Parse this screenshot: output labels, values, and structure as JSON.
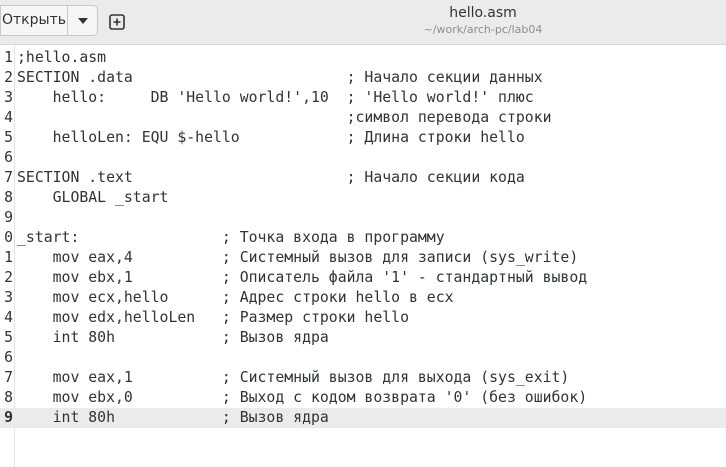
{
  "header": {
    "open_label": "Открыть",
    "title": "hello.asm",
    "subtitle": "~/work/arch-pc/lab04",
    "icons": {
      "dropdown": "chevron-down-icon",
      "new_tab": "new-tab-icon"
    }
  },
  "editor": {
    "current_line_index": 19,
    "lines": [
      {
        "num": "1",
        "text": ";hello.asm"
      },
      {
        "num": "2",
        "text": "SECTION .data                        ; Начало секции данных"
      },
      {
        "num": "3",
        "text": "    hello:     DB 'Hello world!',10  ; 'Hello world!' плюс"
      },
      {
        "num": "4",
        "text": "                                     ;символ перевода строки"
      },
      {
        "num": "5",
        "text": "    helloLen: EQU $-hello            ; Длина строки hello"
      },
      {
        "num": "6",
        "text": ""
      },
      {
        "num": "7",
        "text": "SECTION .text                        ; Начало секции кода"
      },
      {
        "num": "8",
        "text": "    GLOBAL _start"
      },
      {
        "num": "9",
        "text": ""
      },
      {
        "num": "0",
        "text": "_start:                ; Точка входа в программу"
      },
      {
        "num": "1",
        "text": "    mov eax,4          ; Системный вызов для записи (sys_write)"
      },
      {
        "num": "2",
        "text": "    mov ebx,1          ; Описатель файла '1' - стандартный вывод"
      },
      {
        "num": "3",
        "text": "    mov ecx,hello      ; Адрес строки hello в ecx"
      },
      {
        "num": "4",
        "text": "    mov edx,helloLen   ; Размер строки hello"
      },
      {
        "num": "5",
        "text": "    int 80h            ; Вызов ядра"
      },
      {
        "num": "6",
        "text": ""
      },
      {
        "num": "7",
        "text": "    mov eax,1          ; Системный вызов для выхода (sys_exit)"
      },
      {
        "num": "8",
        "text": "    mov ebx,0          ; Выход с кодом возврата '0' (без ошибок)"
      },
      {
        "num": "9",
        "text": "    int 80h            ; Вызов ядра"
      }
    ]
  }
}
